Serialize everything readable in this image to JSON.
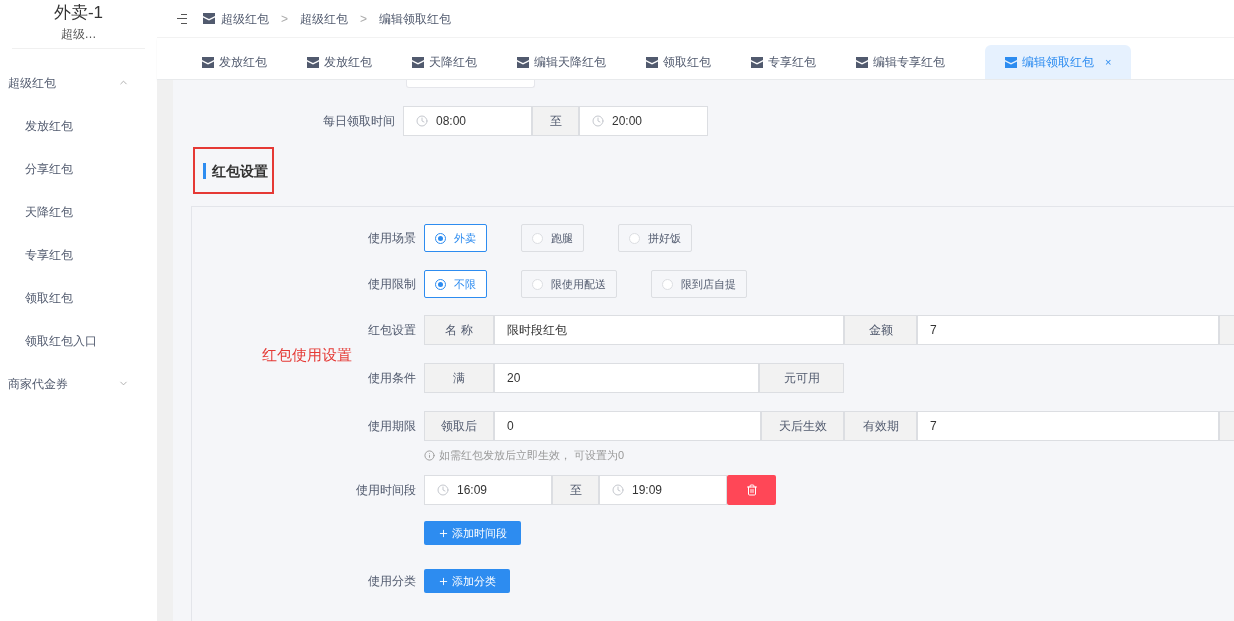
{
  "sidebar": {
    "title": "外卖-1",
    "subtitle": "超级…",
    "groups": [
      {
        "label": "超级红包",
        "expanded": true,
        "children": [
          {
            "label": "发放红包"
          },
          {
            "label": "分享红包"
          },
          {
            "label": "天降红包"
          },
          {
            "label": "专享红包"
          },
          {
            "label": "领取红包"
          },
          {
            "label": "领取红包入口"
          }
        ]
      },
      {
        "label": "商家代金券",
        "expanded": false
      }
    ]
  },
  "breadcrumb": {
    "items": [
      "超级红包",
      "超级红包",
      "编辑领取红包"
    ],
    "separators": [
      ">",
      ">"
    ]
  },
  "tabs": [
    {
      "label": "发放红包",
      "selected": false
    },
    {
      "label": "发放红包",
      "selected": false
    },
    {
      "label": "天降红包",
      "selected": false
    },
    {
      "label": "编辑天降红包",
      "selected": false
    },
    {
      "label": "领取红包",
      "selected": false
    },
    {
      "label": "专享红包",
      "selected": false
    },
    {
      "label": "编辑专享红包",
      "selected": false
    },
    {
      "label": "编辑领取红包",
      "selected": true,
      "close": "×"
    }
  ],
  "daily_time": {
    "label": "每日领取时间",
    "start": "08:00",
    "separator": "至",
    "end": "20:00"
  },
  "section": {
    "title": "红包设置",
    "highlighted": true
  },
  "annotation": "红包使用设置",
  "radio_groups": [
    {
      "label": "使用场景",
      "options": [
        {
          "label": "外卖",
          "selected": true
        },
        {
          "label": "跑腿",
          "selected": false
        },
        {
          "label": "拼好饭",
          "selected": false
        }
      ]
    },
    {
      "label": "使用限制",
      "options": [
        {
          "label": "不限",
          "selected": true
        },
        {
          "label": "限使用配送",
          "selected": false
        },
        {
          "label": "限到店自提",
          "selected": false
        }
      ]
    }
  ],
  "red_packet": {
    "label": "红包设置",
    "name_addon": "名 称",
    "name_value": "限时段红包",
    "amount_addon": "金额",
    "amount_value": "7"
  },
  "condition": {
    "label": "使用条件",
    "prefix": "满",
    "value": "20",
    "suffix": "元可用"
  },
  "period": {
    "label": "使用期限",
    "prefix": "领取后",
    "value": "0",
    "suffix": "天后生效",
    "validity_addon": "有效期",
    "validity_value": "7",
    "hint": "如需红包发放后立即生效， 可设置为0"
  },
  "time_slots": {
    "label": "使用时间段",
    "slots": [
      {
        "start": "16:09",
        "separator": "至",
        "end": "19:09"
      }
    ],
    "add_button": "添加时间段"
  },
  "category": {
    "label": "使用分类",
    "add_button": "添加分类"
  }
}
